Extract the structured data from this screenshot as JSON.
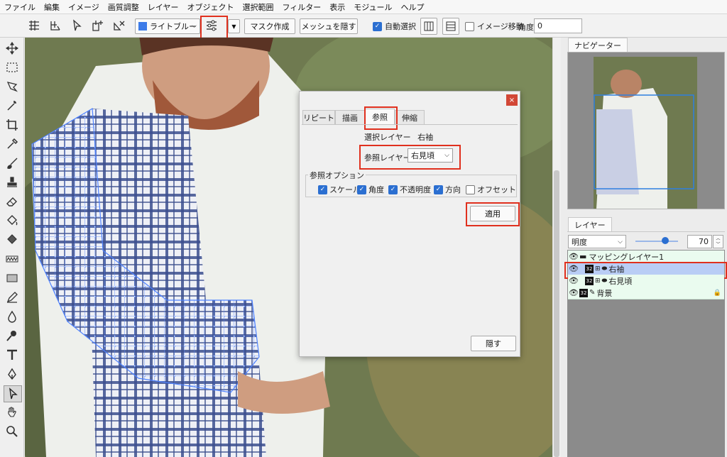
{
  "menu": [
    "ファイル",
    "編集",
    "イメージ",
    "画質調整",
    "レイヤー",
    "オブジェクト",
    "選択範囲",
    "フィルター",
    "表示",
    "モジュール",
    "ヘルプ"
  ],
  "toolbar": {
    "color_name": "ライトブルー",
    "color_swatch": "#3d7be8",
    "mask_button": "マスク作成",
    "hide_mesh_button": "メッシュを隠す",
    "auto_select_label": "自動選択",
    "auto_select_checked": true,
    "move_image_label": "イメージ移動",
    "angle_label": "角度",
    "angle_value": "0"
  },
  "dialog": {
    "close": "×",
    "tabs": [
      "リピート",
      "描画",
      "参照",
      "伸縮"
    ],
    "active_tab": "参照",
    "selected_layer_label": "選択レイヤー",
    "selected_layer_value": "右袖",
    "reference_layer_label": "参照レイヤー",
    "reference_layer_value": "右見頃",
    "options_group_label": "参照オプション",
    "options": [
      {
        "label": "スケール",
        "checked": true
      },
      {
        "label": "角度",
        "checked": true
      },
      {
        "label": "不透明度",
        "checked": true
      },
      {
        "label": "方向",
        "checked": true
      },
      {
        "label": "オフセット",
        "checked": false
      }
    ],
    "apply_button": "適用",
    "hide_button": "隠す"
  },
  "navigator": {
    "tab": "ナビゲーター"
  },
  "layers": {
    "tab": "レイヤー",
    "blend_mode": "明度",
    "opacity": "70",
    "opacity_fraction": 0.7,
    "items": [
      {
        "name": "マッピングレイヤー1",
        "type": "folder",
        "selected": false
      },
      {
        "name": "右袖",
        "type": "mesh",
        "selected": true
      },
      {
        "name": "右見頃",
        "type": "mesh",
        "selected": false
      },
      {
        "name": "背景",
        "type": "raster",
        "selected": false
      }
    ]
  },
  "colors": {
    "highlight": "#e0301e",
    "accent": "#2b6fd1",
    "selection": "#b9cdf5"
  }
}
